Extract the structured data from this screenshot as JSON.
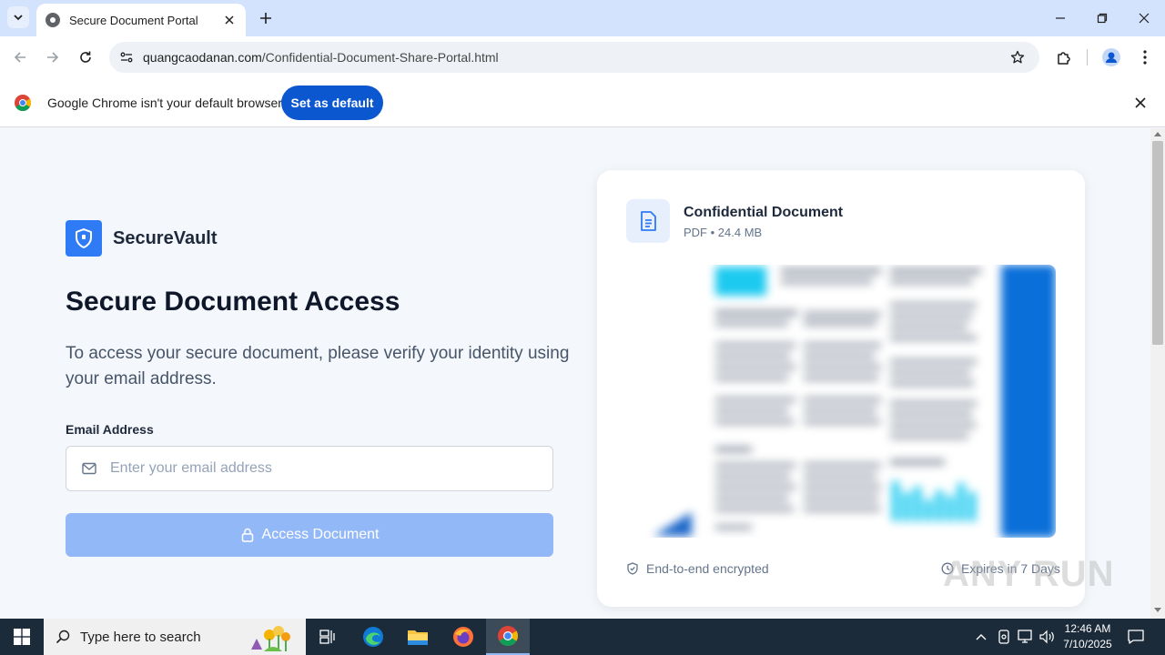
{
  "browser": {
    "tab_title": "Secure Document Portal",
    "url_domain": "quangcaodanan.com",
    "url_path": "/Confidential-Document-Share-Portal.html",
    "infobar_text": "Google Chrome isn't your default browser",
    "set_default_label": "Set as default"
  },
  "page": {
    "brand_name": "SecureVault",
    "heading": "Secure Document Access",
    "subtext": "To access your secure document, please verify your identity using your email address.",
    "email_label": "Email Address",
    "email_placeholder": "Enter your email address",
    "email_value": "",
    "access_button_label": "Access Document",
    "document": {
      "title": "Confidential Document",
      "meta": "PDF • 24.4 MB"
    },
    "footer_left": "End-to-end encrypted",
    "footer_right": "Expires in 7 Days"
  },
  "watermark": "ANY RUN",
  "taskbar": {
    "search_placeholder": "Type here to search",
    "time": "12:46 AM",
    "date": "7/10/2025"
  },
  "colors": {
    "brand_blue": "#2f7bf5",
    "button_disabled": "#93b8f8",
    "chrome_blue": "#0b57d0",
    "heading": "#0f172a"
  },
  "icons": [
    "tab-search-icon",
    "chrome-favicon",
    "close-icon",
    "plus-icon",
    "minimize-icon",
    "restore-icon",
    "back-icon",
    "forward-icon",
    "reload-icon",
    "site-info-icon",
    "star-icon",
    "extensions-icon",
    "profile-icon",
    "more-icon",
    "chrome-logo",
    "shield-icon",
    "mail-icon",
    "lock-icon",
    "document-icon",
    "shield-check-icon",
    "clock-icon",
    "windows-start-icon",
    "search-icon",
    "task-view-icon",
    "edge-icon",
    "file-explorer-icon",
    "firefox-icon",
    "chrome-icon",
    "chevron-up-icon",
    "network-icon",
    "volume-icon",
    "notification-icon"
  ]
}
